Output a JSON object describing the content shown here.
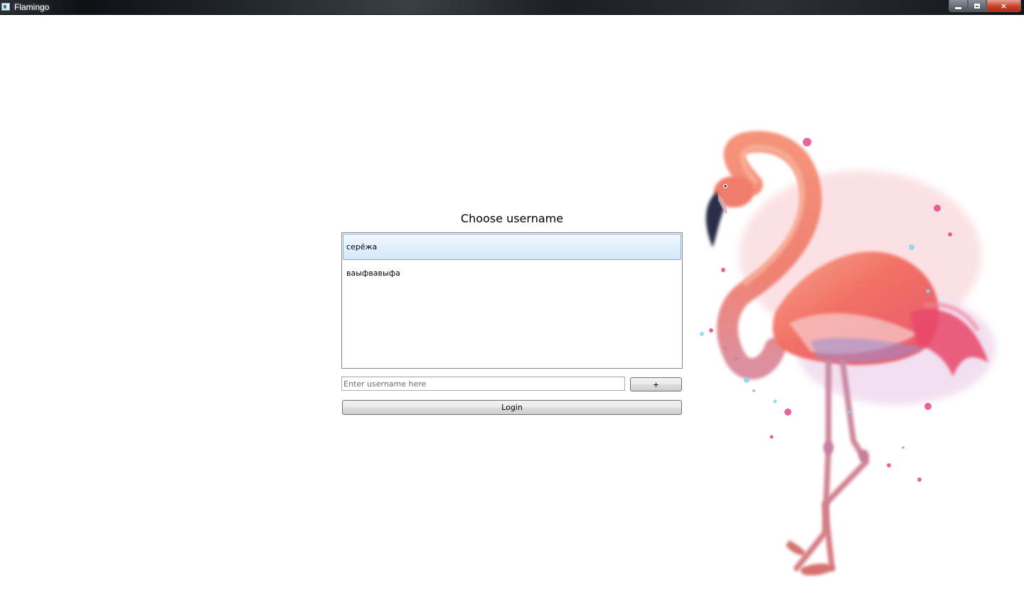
{
  "window": {
    "title": "Flamingo",
    "controls": {
      "minimize": "minimize-icon",
      "maximize": "maximize-icon",
      "close": "×"
    }
  },
  "login": {
    "heading": "Choose username",
    "users": [
      {
        "label": "серёжа",
        "selected": true
      },
      {
        "label": "ваыфвавыфа",
        "selected": false
      }
    ],
    "username_input": {
      "value": "",
      "placeholder": "Enter username here"
    },
    "add_button_label": "+",
    "login_button_label": "Login"
  },
  "illustration": {
    "subject": "watercolor flamingo",
    "colors": {
      "body": "#f26a5e",
      "neck": "#ef7a6b",
      "beak": "#2b2f4a",
      "legs": "#b27b9d",
      "wing_shade": "#9a8fd0",
      "splash_pink": "#e24a8a",
      "splash_cyan": "#7fd6e6"
    }
  },
  "colors": {
    "selection_top": "#f1f8fe",
    "selection_bottom": "#d5e8fb",
    "selection_border": "#84acdd",
    "titlebar": "#1b1e22",
    "close_button": "#c5442c"
  }
}
